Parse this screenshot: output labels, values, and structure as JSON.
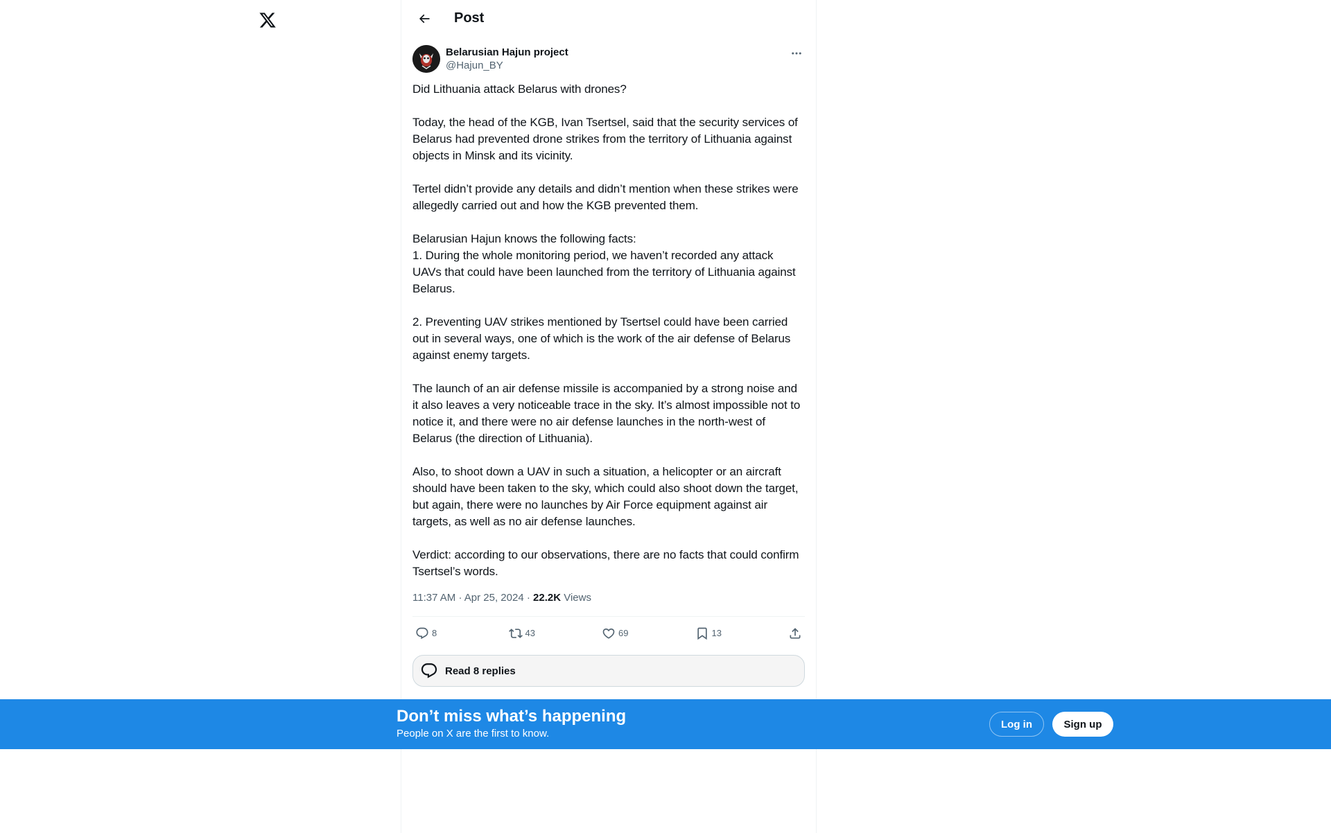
{
  "nav": {
    "logo": "x-logo-icon"
  },
  "header": {
    "back_icon": "arrow-left-icon",
    "title": "Post"
  },
  "post": {
    "author": {
      "display_name": "Belarusian Hajun project",
      "handle": "@Hajun_BY"
    },
    "body": "Did Lithuania attack Belarus with drones?\n\nToday, the head of the KGB, Ivan Tsertsel, said that the security services of Belarus had prevented drone strikes from the territory of Lithuania against objects in Minsk and its vicinity.\n\nTertel didn’t provide any details and didn’t mention when these strikes were allegedly carried out and how the KGB prevented them.\n\nBelarusian Hajun knows the following facts:\n1. During the whole monitoring period, we haven’t recorded any attack UAVs that could have been launched from the territory of Lithuania against Belarus.\n\n2. Preventing UAV strikes mentioned by Tsertsel could have been carried out in several ways, one of which is the work of the air defense of Belarus against enemy targets.\n\nThe launch of an air defense missile is accompanied by a strong noise and it also leaves a very noticeable trace in the sky. It’s almost impossible not to notice it, and there were no air defense launches in the north-west of Belarus (the direction of Lithuania).\n\nAlso, to shoot down a UAV in such a situation, a helicopter or an aircraft should have been taken to the sky, which could also shoot down the target, but again, there were no launches by Air Force equipment against air targets, as well as no air defense launches.\n\nVerdict: according to our observations, there are no facts that could confirm Tsertsel’s words.",
    "time": "11:37 AM",
    "separator": "·",
    "date": "Apr 25, 2024",
    "views_count": "22.2K",
    "views_label": "Views",
    "actions": {
      "replies": "8",
      "reposts": "43",
      "likes": "69",
      "bookmarks": "13"
    },
    "read_replies_label": "Read 8 replies"
  },
  "banner": {
    "title": "Don’t miss what’s happening",
    "subtitle": "People on X are the first to know.",
    "login_label": "Log in",
    "signup_label": "Sign up"
  },
  "colors": {
    "banner_bg": "#1e88e5",
    "text_primary": "#0f1419",
    "text_secondary": "#536471",
    "border": "#eff3f4"
  }
}
